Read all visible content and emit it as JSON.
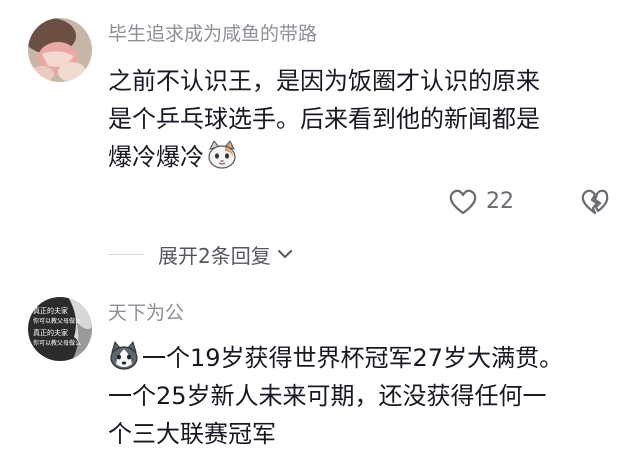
{
  "comments": [
    {
      "username": "毕生追求成为咸鱼的带路",
      "lines": [
        "之前不认识王，是因为饭圈才认识的原来",
        "是个乒乓球选手。后来看到他的新闻都是",
        "爆冷爆冷"
      ],
      "trailing_emoji": "cat-emoji",
      "likes": "22",
      "reply_toggle": "展开2条回复"
    },
    {
      "username": "天下为公",
      "leading_emoji": "husky-emoji",
      "lines": [
        "一个19岁获得世界杯冠军27岁大满贯。",
        "一个25岁新人未来可期，还没获得任何一",
        "个三大联赛冠军"
      ],
      "avatar_text": [
        "真正的夫家",
        "你可以教父母做么",
        "真正的夫家",
        "你可以教父母做么"
      ]
    }
  ],
  "colors": {
    "text_primary": "#161823",
    "text_secondary": "#8e8f97",
    "icon": "#6a6b73"
  }
}
